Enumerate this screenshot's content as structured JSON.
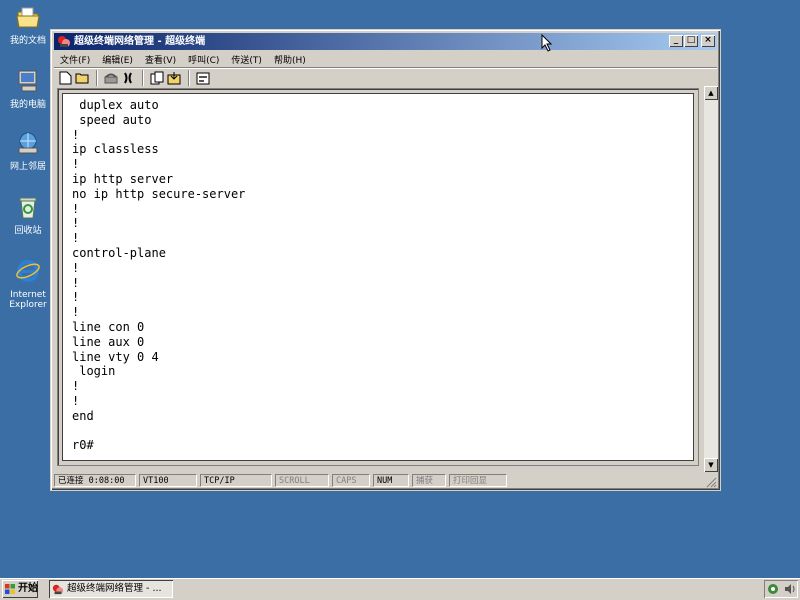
{
  "desktop": {
    "icons": [
      {
        "label": "我的文档"
      },
      {
        "label": "我的电脑"
      },
      {
        "label": "网上邻居"
      },
      {
        "label": "回收站"
      },
      {
        "label_line1": "Internet",
        "label_line2": "Explorer"
      }
    ]
  },
  "window": {
    "title": "超级终端网络管理 - 超级终端",
    "controls": {
      "minimize": "_",
      "maximize": "□",
      "close": "×"
    },
    "menu": [
      "文件(F)",
      "编辑(E)",
      "查看(V)",
      "呼叫(C)",
      "传送(T)",
      "帮助(H)"
    ],
    "terminal_lines": [
      " duplex auto",
      " speed auto",
      "!",
      "ip classless",
      "!",
      "ip http server",
      "no ip http secure-server",
      "!",
      "!",
      "!",
      "control-plane",
      "!",
      "!",
      "!",
      "!",
      "line con 0",
      "line aux 0",
      "line vty 0 4",
      " login",
      "!",
      "!",
      "end",
      "",
      "r0#"
    ],
    "status": {
      "connected": "已连接 0:08:00",
      "emulation": "VT100",
      "protocol": "TCP/IP",
      "scroll": "SCROLL",
      "caps": "CAPS",
      "num": "NUM",
      "capture": "捕获",
      "print_echo": "打印回显"
    }
  },
  "taskbar": {
    "start_label": "开始",
    "task_label": "超级终端网络管理 - ..."
  },
  "colors": {
    "desktop": "#3a6ea5",
    "titlebar_start": "#0a246a",
    "titlebar_end": "#a6caf0",
    "face": "#d4d0c8"
  }
}
